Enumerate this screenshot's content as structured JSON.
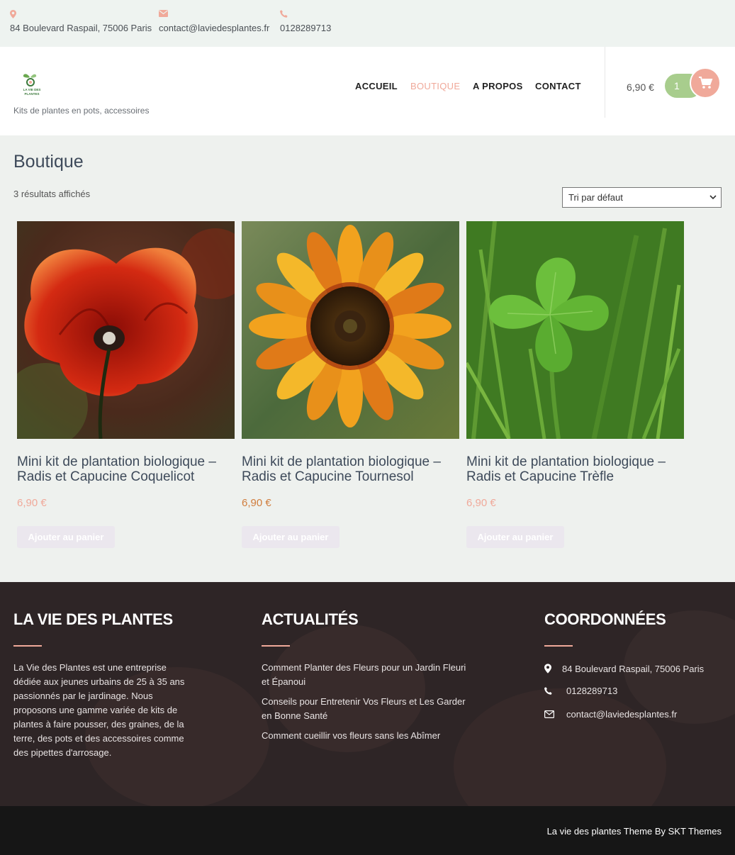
{
  "topbar": {
    "address": "84 Boulevard Raspail, 75006 Paris",
    "email": "contact@laviedesplantes.fr",
    "phone": "0128289713"
  },
  "header": {
    "logo_text": "LA VIE DES PLANTES",
    "tagline": "Kits de plantes en pots, accessoires",
    "nav": [
      "ACCUEIL",
      "BOUTIQUE",
      "A PROPOS",
      "CONTACT"
    ],
    "active_nav": "BOUTIQUE",
    "cart_total": "6,90 €",
    "cart_count": "1"
  },
  "main": {
    "title": "Boutique",
    "results": "3 résultats affichés",
    "sort_selected": "Tri par défaut"
  },
  "products": [
    {
      "title": "Mini kit de plantation biologique – Radis et Capucine Coquelicot",
      "price": "6,90 €",
      "button": "Ajouter au panier",
      "image": "poppy"
    },
    {
      "title": "Mini kit de plantation biologique – Radis et Capucine Tournesol",
      "price": "6,90 €",
      "button": "Ajouter au panier",
      "image": "sunflower"
    },
    {
      "title": "Mini kit de plantation biologique – Radis et Capucine Trèfle",
      "price": "6,90 €",
      "button": "Ajouter au panier",
      "image": "clover"
    }
  ],
  "footer": {
    "about_title": "LA VIE DES PLANTES",
    "about_text": "La Vie des Plantes est une entreprise dédiée aux jeunes urbains de 25 à 35 ans passionnés par le jardinage. Nous proposons une gamme variée de kits de plantes à faire pousser, des graines, de la terre, des pots et des accessoires comme des pipettes d'arrosage.",
    "news_title": "ACTUALITÉS",
    "news": [
      "Comment Planter des Fleurs pour un Jardin Fleuri et Épanoui",
      "Conseils pour Entretenir Vos Fleurs et Les Garder en Bonne Santé",
      "Comment cueillir vos fleurs sans les Abîmer"
    ],
    "contact_title": "COORDONNÉES",
    "contact_address": "84 Boulevard Raspail, 75006 Paris",
    "contact_phone": "0128289713",
    "contact_email": "contact@laviedesplantes.fr",
    "credit": "La vie des plantes Theme By SKT Themes"
  },
  "colors": {
    "accent": "#f0a99a",
    "cart_green": "#a8cd8d",
    "footer_bg": "#2e2526"
  }
}
